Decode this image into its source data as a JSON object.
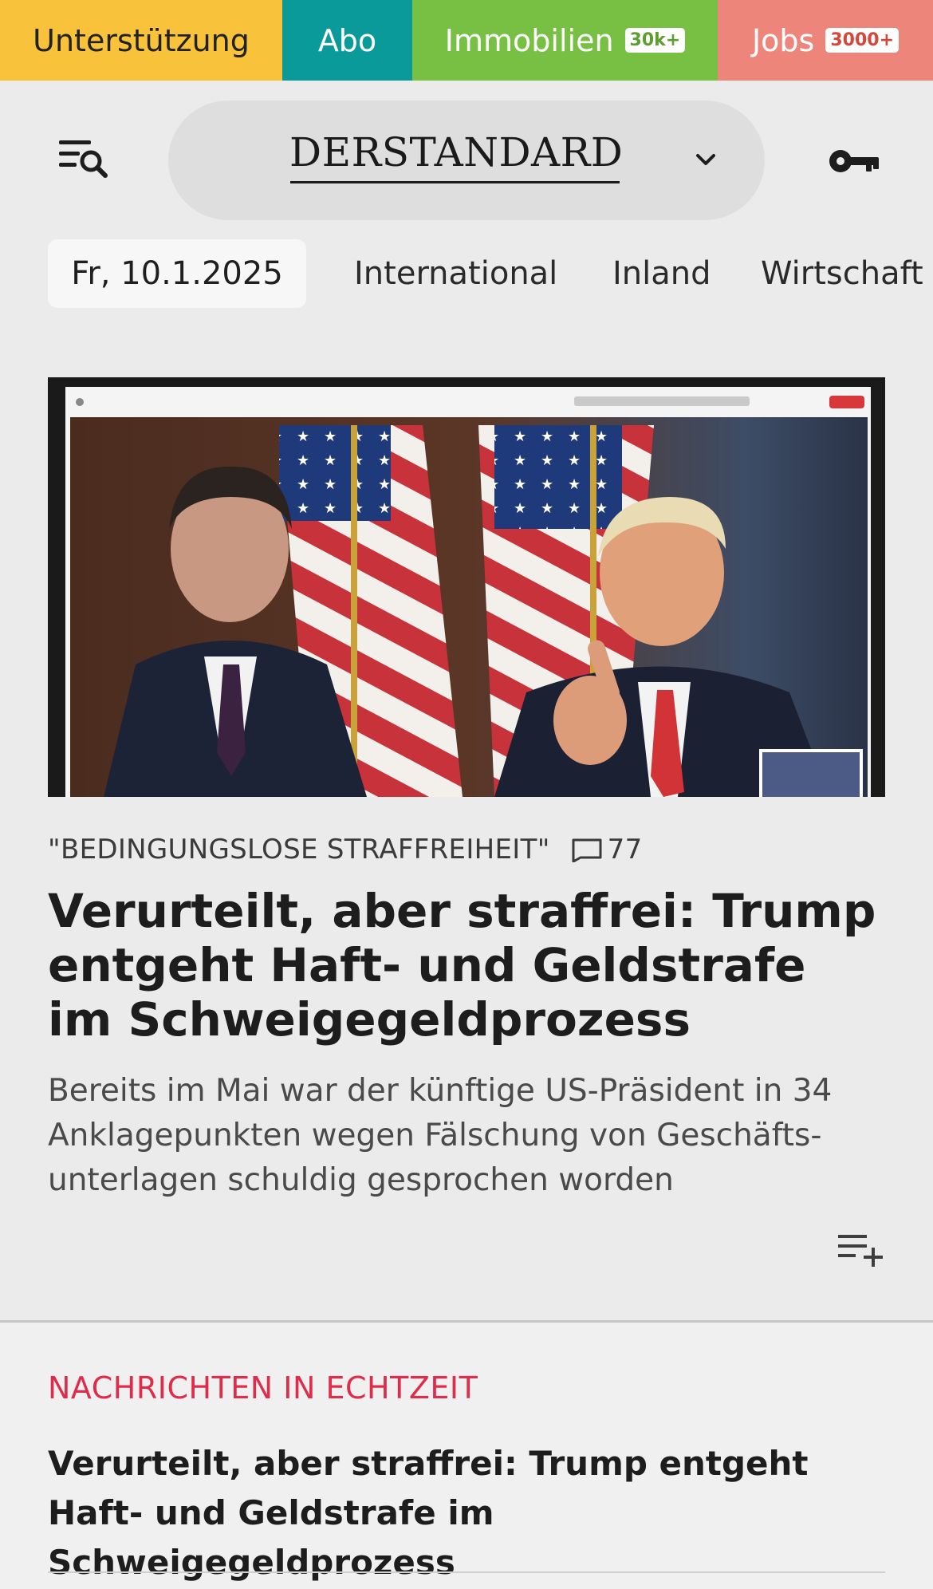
{
  "topbar": {
    "support_label": "Unterstützung",
    "abo_label": "Abo",
    "immobilien_label": "Immobilien",
    "immobilien_badge": "30k+",
    "jobs_label": "Jobs",
    "jobs_badge": "3000+",
    "colors": {
      "support": "#f8c33a",
      "abo": "#0b9a9a",
      "immobilien": "#78c043",
      "jobs": "#ee857b"
    }
  },
  "header": {
    "logo_text": "DERSTANDARD",
    "icons": {
      "menu": "menu-search-icon",
      "logo_dropdown": "chevron-down-icon",
      "login": "key-icon"
    }
  },
  "nav": {
    "date": "Fr, 10.1.2025",
    "items": [
      "International",
      "Inland",
      "Wirtschaft"
    ]
  },
  "article": {
    "kicker": "\"BEDINGUNGSLOSE STRAFFREIHEIT\"",
    "comment_count": "77",
    "headline": "Verurteilt, aber straffrei: Trump entgeht Haft- und Geldstrafe im Schweigegeldprozess",
    "teaser": "Bereits im Mai war der künftige US-Präsident in 34 Anklagepunkten wegen Fälschung von Geschäfts-unterlagen schuldig gesprochen worden",
    "playlist_icon": "playlist-add-icon"
  },
  "live": {
    "label": "NACHRICHTEN IN ECHTZEIT",
    "headline": "Verurteilt, aber straffrei: Trump entgeht Haft- und Geldstrafe im Schweigegeldprozess",
    "accent_color": "#df2c4a"
  }
}
